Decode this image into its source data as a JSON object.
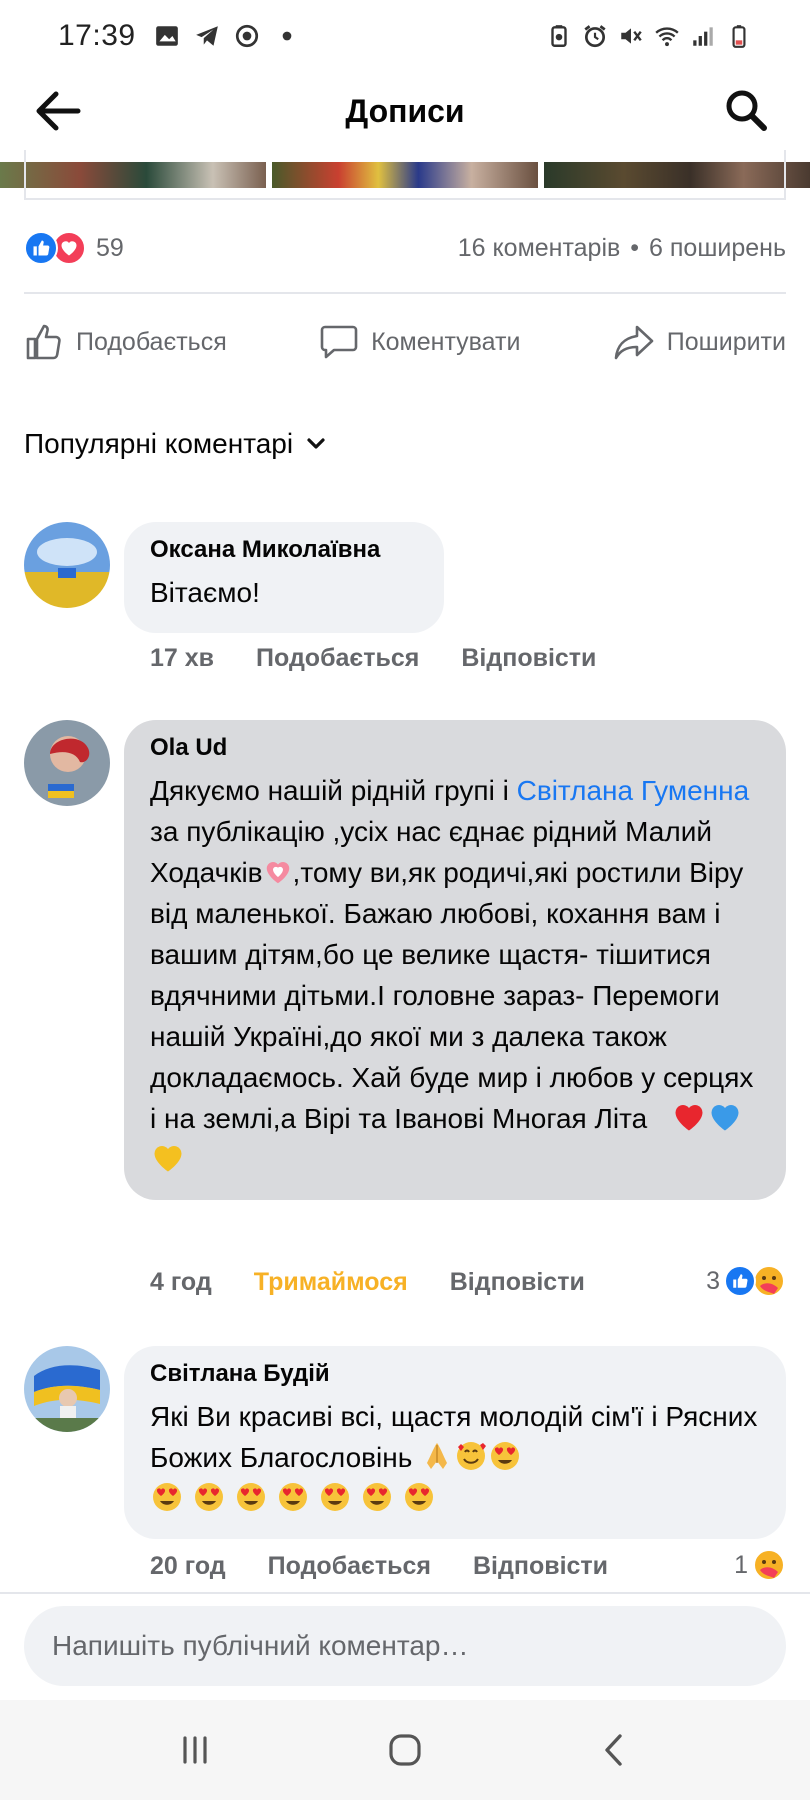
{
  "status_bar": {
    "time": "17:39"
  },
  "header": {
    "title": "Дописи"
  },
  "post": {
    "reaction_count": "59",
    "comments_count": "16 коментарів",
    "separator": "•",
    "shares_count": "6 поширень",
    "actions": {
      "like": "Подобається",
      "comment": "Коментувати",
      "share": "Поширити"
    }
  },
  "sort": {
    "label": "Популярні коментарі"
  },
  "comments": [
    {
      "author": "Оксана Миколаївна",
      "text": "Вітаємо!",
      "time": "17 хв",
      "like_label": "Подобається",
      "reply_label": "Відповісти"
    },
    {
      "author": "Ola Ud",
      "text_before_link": "Дякуємо нашій рідній групі і ",
      "link": "Світлана Гуменна",
      "text_after_link": " за публікацію ,усіх  нас єднає рідний Малий Ходачків",
      "text_rest": ",тому ви,як родичі,які ростили Віру від маленької. Бажаю любові, кохання вам і вашим дітям,бо це велике щастя- тішитися вдячними дітьми.І головне зараз- Перемоги   нашій Україні,до якої ми з далека також докладаємось. Хай буде мир і любов у серцях і на землі,а Вірі та Іванові Многая Літа",
      "time": "4 год",
      "like_label": "Тримаймося",
      "reply_label": "Відповісти",
      "reaction_count": "3"
    },
    {
      "author": "Світлана Будій",
      "text": "Які Ви красиві всі, щастя молодій сім'ї і Рясних Божих Благословінь",
      "time": "20 год",
      "like_label": "Подобається",
      "reply_label": "Відповісти",
      "reaction_count": "1"
    }
  ],
  "composer": {
    "placeholder": "Напишіть публічний коментар…"
  },
  "colors": {
    "accent": "#1877f2",
    "love": "#f33e58",
    "care": "#f7b125",
    "meta": "#65676b"
  }
}
